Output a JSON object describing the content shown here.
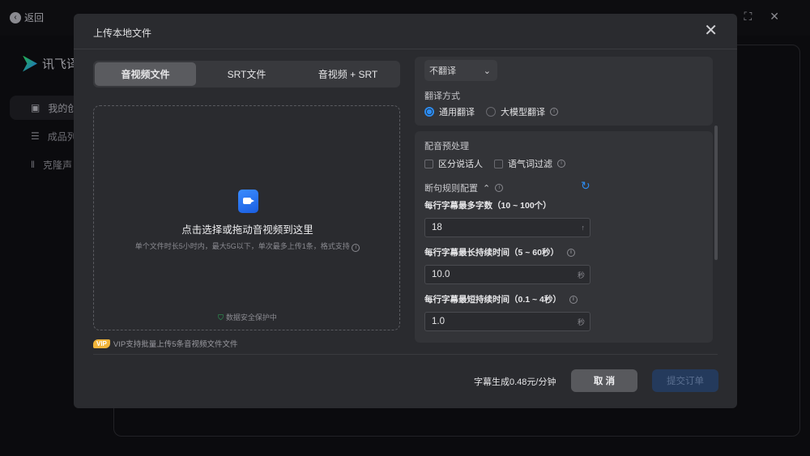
{
  "app": {
    "back_label": "返回",
    "logo_text": "讯飞译",
    "sidebar": [
      {
        "label": "我的创"
      },
      {
        "label": "成品列"
      },
      {
        "label": "克隆声"
      }
    ]
  },
  "modal": {
    "title": "上传本地文件",
    "tabs": [
      {
        "label": "音视频文件",
        "active": true
      },
      {
        "label": "SRT文件"
      },
      {
        "label": "音视频 + SRT"
      }
    ],
    "drop": {
      "title": "点击选择或拖动音视频到这里",
      "subtitle": "单个文件时长5小时内，最大5G以下，单次最多上传1条，格式支持",
      "secure": "数据安全保护中"
    },
    "vip": {
      "badge": "VIP",
      "text": "VIP支持批量上传5条音视频文件文件"
    },
    "translate": {
      "select_value": "不翻译",
      "method_label": "翻译方式",
      "options": [
        {
          "label": "通用翻译",
          "checked": true
        },
        {
          "label": "大模型翻译",
          "checked": false
        }
      ]
    },
    "preprocess": {
      "label": "配音预处理",
      "options": [
        {
          "label": "区分说话人",
          "checked": false
        },
        {
          "label": "语气词过滤",
          "checked": false
        }
      ]
    },
    "rules": {
      "label": "断句规则配置",
      "fields": [
        {
          "label": "每行字幕最多字数（10 ~ 100个）",
          "value": "18",
          "unit": ""
        },
        {
          "label": "每行字幕最长持续时间（5 ~ 60秒）",
          "value": "10.0",
          "unit": "秒"
        },
        {
          "label": "每行字幕最短持续时间（0.1 ~ 4秒）",
          "value": "1.0",
          "unit": "秒"
        }
      ]
    },
    "footer": {
      "price": "字幕生成0.48元/分钟",
      "cancel": "取 消",
      "submit": "提交订单"
    }
  }
}
